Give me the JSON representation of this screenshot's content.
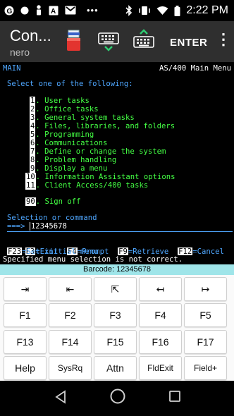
{
  "status_bar": {
    "time": "2:22 PM",
    "left_icons": [
      "google-icon",
      "notification-dot-icon",
      "person-icon",
      "a-icon",
      "gmail-icon",
      "more-dots-icon"
    ],
    "right_icons": [
      "bluetooth-icon",
      "vibrate-icon",
      "wifi-icon",
      "battery-icon"
    ]
  },
  "app_bar": {
    "title": "Con...",
    "subtitle": "nero",
    "enter_label": "ENTER"
  },
  "terminal": {
    "top_left": "MAIN",
    "top_right": "AS/400 Main Menu",
    "prompt": "Select one of the following:",
    "options": [
      {
        "num": "1",
        "text": ". User tasks"
      },
      {
        "num": "2",
        "text": ". Office tasks"
      },
      {
        "num": "3",
        "text": ". General system tasks"
      },
      {
        "num": "4",
        "text": ". Files, libraries, and folders"
      },
      {
        "num": "5",
        "text": ". Programming"
      },
      {
        "num": "6",
        "text": ". Communications"
      },
      {
        "num": "7",
        "text": ". Define or change the system"
      },
      {
        "num": "8",
        "text": ". Problem handling"
      },
      {
        "num": "9",
        "text": ". Display a menu"
      },
      {
        "num": "10",
        "text": ". Information Assistant options"
      },
      {
        "num": "11",
        "text": ". Client Access/400 tasks"
      }
    ],
    "signoff": {
      "num": "90",
      "text": ". Sign off"
    },
    "command_label": "Selection or command",
    "command_arrow": "===>",
    "command_value": "12345678",
    "fkeys_line1": [
      {
        "key": "F3",
        "label": "=Exit"
      },
      {
        "key": "F4",
        "label": "=Prompt"
      },
      {
        "key": "F9",
        "label": "=Retrieve"
      },
      {
        "key": "F12",
        "label": "=Cancel"
      }
    ],
    "fkeys_line2": {
      "key": "F23",
      "label": "=Set initial menu"
    },
    "message": "Specified menu selection is not correct."
  },
  "barcode_bar": "Barcode: 12345678",
  "keypad": {
    "row1": [
      "tab-right-icon",
      "tab-left-icon",
      "home-icon",
      "backspace-icon",
      "cursor-right-icon"
    ],
    "row1_glyphs": [
      "⇥",
      "⇤",
      "⇱",
      "↤",
      "↦"
    ],
    "row2": [
      "F1",
      "F2",
      "F3",
      "F4",
      "F5"
    ],
    "row3": [
      "F13",
      "F14",
      "F15",
      "F16",
      "F17"
    ],
    "row4": [
      "Help",
      "SysRq",
      "Attn",
      "FldExit",
      "Field+"
    ]
  },
  "nav_bar": [
    "back-icon",
    "home-icon",
    "recents-icon"
  ],
  "colors": {
    "terminal_blue": "#4fa7ff",
    "terminal_green": "#44ff44",
    "appbar": "#2f2f2f",
    "barcode_bg": "#9fe5e9"
  }
}
